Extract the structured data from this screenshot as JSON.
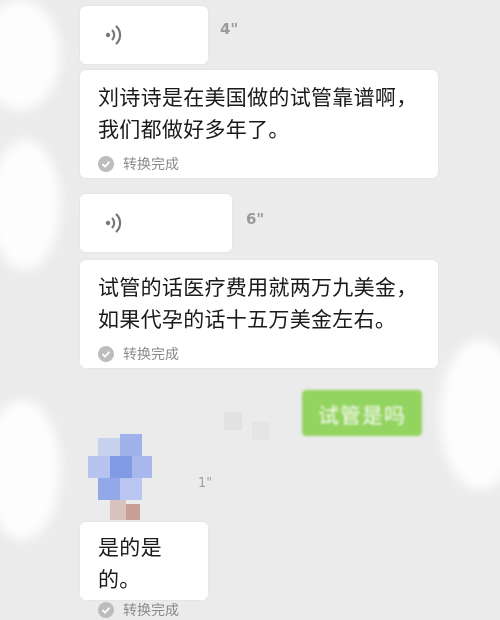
{
  "messages": [
    {
      "type": "voice",
      "duration": "4\""
    },
    {
      "type": "transcription",
      "text": "刘诗诗是在美国做的试管靠谱啊，我们都做好多年了。",
      "status": "转换完成"
    },
    {
      "type": "voice",
      "duration": "6\""
    },
    {
      "type": "transcription",
      "text": "试管的话医疗费用就两万九美金，如果代孕的话十五万美金左右。",
      "status": "转换完成"
    },
    {
      "type": "sent",
      "text": "试管是吗"
    },
    {
      "type": "voice",
      "duration": "1\""
    },
    {
      "type": "transcription",
      "text": "是的是的。",
      "status": "转换完成"
    }
  ],
  "colors": {
    "background": "#ebebeb",
    "bubble": "#ffffff",
    "sent_bubble": "#93d35f",
    "status": "#8a8a8a"
  },
  "icons": {
    "voice": "voice-wave-icon",
    "status": "check-circle-icon",
    "avatar": "pixelated-avatar"
  }
}
